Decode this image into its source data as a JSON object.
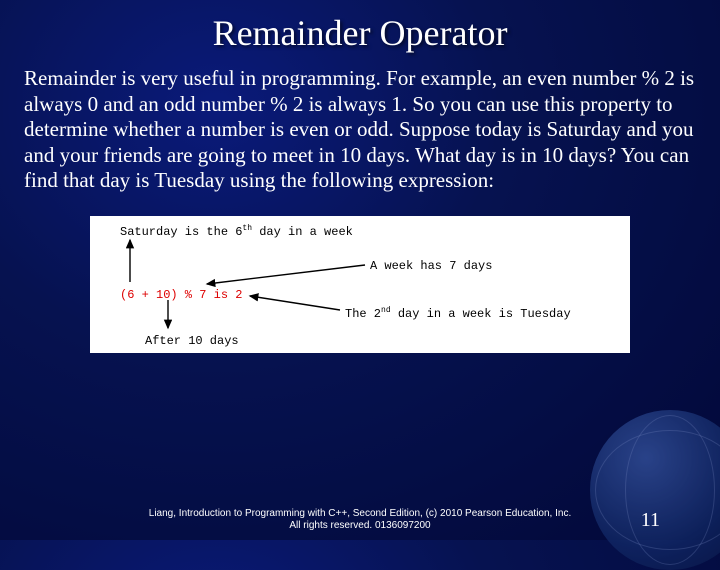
{
  "title": "Remainder Operator",
  "body": "Remainder is very useful in programming. For example, an even number % 2 is always 0 and an odd number % 2 is always 1. So you can use this property to determine whether a number is even or odd. Suppose today is Saturday and you and your friends are going to meet in 10 days. What day is in 10 days? You can find that day is Tuesday using the following expression:",
  "diagram": {
    "line_top_a": "Saturday is the 6",
    "line_top_sup": "th",
    "line_top_b": " day in a week",
    "anno_week": "A week has 7 days",
    "expr": "(6 + 10) % 7 is 2",
    "anno_2nd_a": "The 2",
    "anno_2nd_sup": "nd",
    "anno_2nd_b": " day in a week is Tuesday",
    "anno_after": "After 10 days"
  },
  "footer_line1": "Liang, Introduction to Programming with C++, Second Edition, (c) 2010 Pearson Education, Inc.",
  "footer_line2": "All rights reserved. 0136097200",
  "page_number": "11"
}
